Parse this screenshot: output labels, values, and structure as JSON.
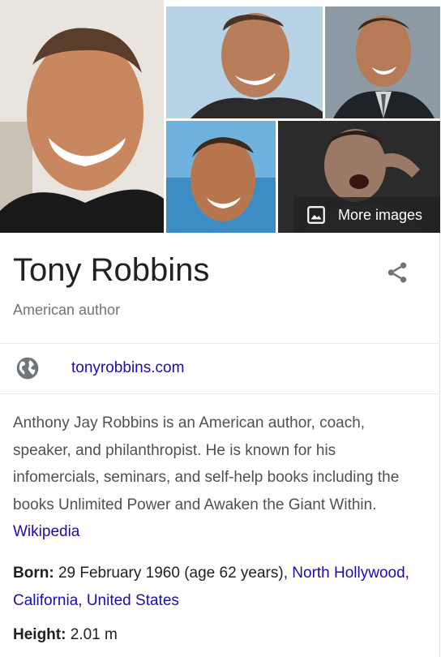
{
  "collage": {
    "more_images_label": "More images"
  },
  "entity": {
    "name": "Tony Robbins",
    "subtitle": "American author"
  },
  "website": {
    "label": "tonyrobbins.com"
  },
  "description": {
    "text": "Anthony Jay Robbins is an American author, coach, speaker, and philanthropist. He is known for his infomercials, seminars, and self-help books including the books Unlimited Power and Awaken the Giant Within.",
    "source_link": "Wikipedia"
  },
  "facts": {
    "born": {
      "label": "Born:",
      "value": "29 February 1960 (age 62 years),",
      "place_link_1": "North Hollywood, California,",
      "place_link_2": "United States"
    },
    "height": {
      "label": "Height:",
      "value": "2.01 m"
    }
  },
  "colors": {
    "link": "#1a0dab",
    "text": "#202124",
    "muted": "#70757a",
    "body_text": "#4d5156"
  },
  "icons": [
    "image-icon",
    "share-icon",
    "globe-icon"
  ]
}
